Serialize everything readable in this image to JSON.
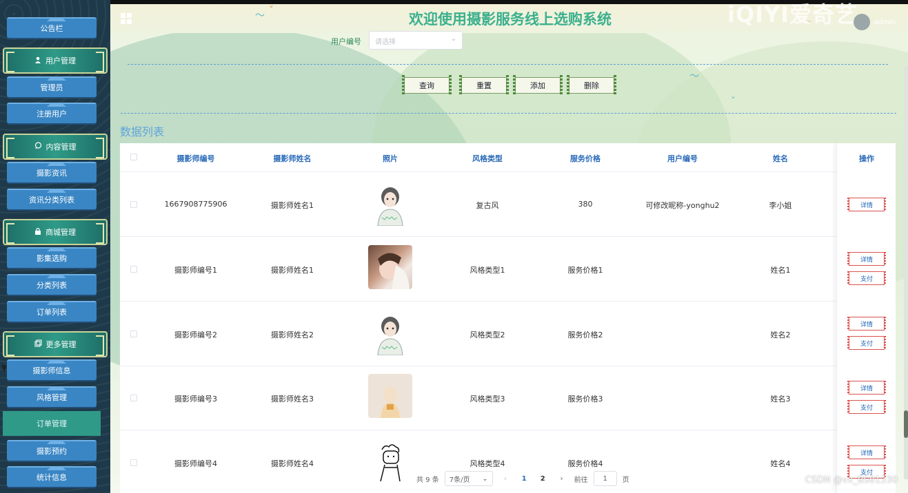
{
  "header": {
    "title": "欢迎使用摄影服务线上选购系统",
    "watermark": "iQIYI爱奇艺",
    "user": "admin"
  },
  "sidebar": {
    "items": [
      {
        "label": "公告栏",
        "kind": "item"
      },
      {
        "label": "用户管理",
        "kind": "group",
        "icon": "user-icon"
      },
      {
        "label": "管理员",
        "kind": "item"
      },
      {
        "label": "注册用户",
        "kind": "item"
      },
      {
        "label": "内容管理",
        "kind": "group",
        "icon": "chat-icon"
      },
      {
        "label": "摄影资讯",
        "kind": "item"
      },
      {
        "label": "资讯分类列表",
        "kind": "item"
      },
      {
        "label": "商城管理",
        "kind": "group",
        "icon": "lock-icon"
      },
      {
        "label": "影集选购",
        "kind": "item"
      },
      {
        "label": "分类列表",
        "kind": "item"
      },
      {
        "label": "订单列表",
        "kind": "item"
      },
      {
        "label": "更多管理",
        "kind": "group",
        "icon": "copy-icon"
      },
      {
        "label": "摄影师信息",
        "kind": "item"
      },
      {
        "label": "风格管理",
        "kind": "item"
      },
      {
        "label": "订单管理",
        "kind": "active"
      },
      {
        "label": "摄影预约",
        "kind": "item"
      },
      {
        "label": "统计信息",
        "kind": "item"
      }
    ]
  },
  "filter": {
    "label": "用户编号",
    "placeholder": "请选择",
    "buttons": [
      "查询",
      "重置",
      "添加",
      "删除"
    ]
  },
  "section_title": "数据列表",
  "table": {
    "columns": [
      "摄影师编号",
      "摄影师姓名",
      "照片",
      "风格类型",
      "服务价格",
      "用户编号",
      "姓名",
      "操作"
    ],
    "rows": [
      {
        "photographer_no": "1667908775906",
        "photographer_name": "摄影师姓名1",
        "photo": "cartoon-girl",
        "style": "复古风",
        "price": "380",
        "user_no": "可修改昵称-yonghu2",
        "name": "李小姐",
        "actions": [
          "详情"
        ]
      },
      {
        "photographer_no": "摄影师编号1",
        "photographer_name": "摄影师姓名1",
        "photo": "portrait-girl",
        "style": "风格类型1",
        "price": "服务价格1",
        "user_no": "",
        "name": "姓名1",
        "actions": [
          "详情",
          "支付"
        ]
      },
      {
        "photographer_no": "摄影师编号2",
        "photographer_name": "摄影师姓名2",
        "photo": "cartoon-girl",
        "style": "风格类型2",
        "price": "服务价格2",
        "user_no": "",
        "name": "姓名2",
        "actions": [
          "详情",
          "支付"
        ]
      },
      {
        "photographer_no": "摄影师编号3",
        "photographer_name": "摄影师姓名3",
        "photo": "soft-photo",
        "style": "风格类型3",
        "price": "服务价格3",
        "user_no": "",
        "name": "姓名3",
        "actions": [
          "详情",
          "支付"
        ]
      },
      {
        "photographer_no": "摄影师编号4",
        "photographer_name": "摄影师姓名4",
        "photo": "sketch-figure",
        "style": "风格类型4",
        "price": "服务价格4",
        "user_no": "",
        "name": "姓名4",
        "actions": [
          "详情",
          "支付"
        ]
      }
    ]
  },
  "pagination": {
    "total": "共 9 条",
    "page_size": "7条/页",
    "pages": [
      "1",
      "2"
    ],
    "current_page": "1",
    "goto_label": "前往",
    "goto_value": "1",
    "page_suffix": "页"
  },
  "overlay": {
    "csdn": "CSDN @vx_BS81330"
  },
  "colors": {
    "title": "#3bb08e",
    "sidebar_item": "#3a86c4",
    "header_text": "#2a6ab8",
    "active_item": "#2f9a87"
  }
}
